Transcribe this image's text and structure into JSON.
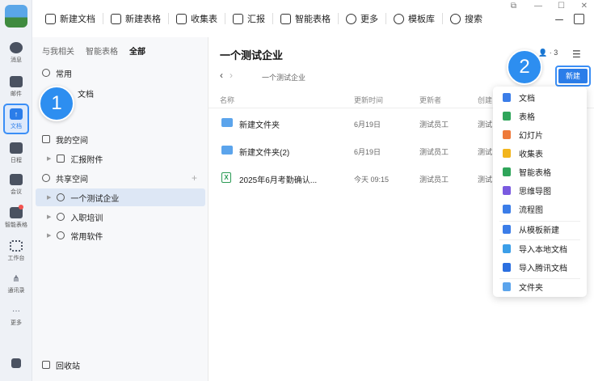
{
  "rail": {
    "items": [
      {
        "label": "消息",
        "icon": "chat-bubble-icon"
      },
      {
        "label": "邮件",
        "icon": "mail-icon"
      },
      {
        "label": "文档",
        "icon": "document-icon"
      },
      {
        "label": "日程",
        "icon": "calendar-icon"
      },
      {
        "label": "会议",
        "icon": "meeting-icon"
      },
      {
        "label": "智能表格",
        "icon": "smart-table-icon"
      },
      {
        "label": "工作台",
        "icon": "workbench-icon"
      },
      {
        "label": "通讯录",
        "icon": "contacts-icon"
      },
      {
        "label": "更多",
        "icon": "more-icon"
      }
    ]
  },
  "toolbar": {
    "new_doc": "新建文档",
    "new_sheet": "新建表格",
    "collect": "收集表",
    "report": "汇报",
    "smart_sheet": "智能表格",
    "more": "更多",
    "templates": "模板库",
    "search": "搜索"
  },
  "sidebar": {
    "tabs": [
      "与我相关",
      "智能表格",
      "全部"
    ],
    "common": "常用",
    "partial_doc": "文档",
    "my_space": "我的空间",
    "report_attach": "汇报附件",
    "shared_space": "共享空间",
    "shared_items": [
      "一个测试企业",
      "入职培训",
      "常用软件"
    ],
    "trash": "回收站"
  },
  "main": {
    "title": "一个测试企业",
    "breadcrumb": "一个测试企业",
    "member_count": "3",
    "new_button": "新建",
    "columns": {
      "name": "名称",
      "updated": "更新时间",
      "updater": "更新者",
      "creator": "创建"
    },
    "rows": [
      {
        "name": "新建文件夹",
        "date": "6月19日",
        "updater": "测试员工",
        "creator": "测试"
      },
      {
        "name": "新建文件夹(2)",
        "date": "6月19日",
        "updater": "测试员工",
        "creator": "测试"
      },
      {
        "name": "2025年6月考勤确认...",
        "date": "今天 09:15",
        "updater": "测试员工",
        "creator": "测试"
      }
    ]
  },
  "dropdown": {
    "items": [
      {
        "label": "文档",
        "color": "#3b7de8"
      },
      {
        "label": "表格",
        "color": "#2fa55a"
      },
      {
        "label": "幻灯片",
        "color": "#ee7a3a"
      },
      {
        "label": "收集表",
        "color": "#f2b51c"
      },
      {
        "label": "智能表格",
        "color": "#2fa55a"
      },
      {
        "label": "思维导图",
        "color": "#7a5ae0"
      },
      {
        "label": "流程图",
        "color": "#3b7de8"
      },
      {
        "label": "从模板新建",
        "color": "#3b7de8"
      },
      {
        "label": "导入本地文档",
        "color": "#3b9ee8"
      },
      {
        "label": "导入腾讯文档",
        "color": "#2b6fe0"
      },
      {
        "label": "文件夹",
        "color": "#5ba4ec"
      }
    ]
  },
  "badges": {
    "one": "1",
    "two": "2"
  }
}
